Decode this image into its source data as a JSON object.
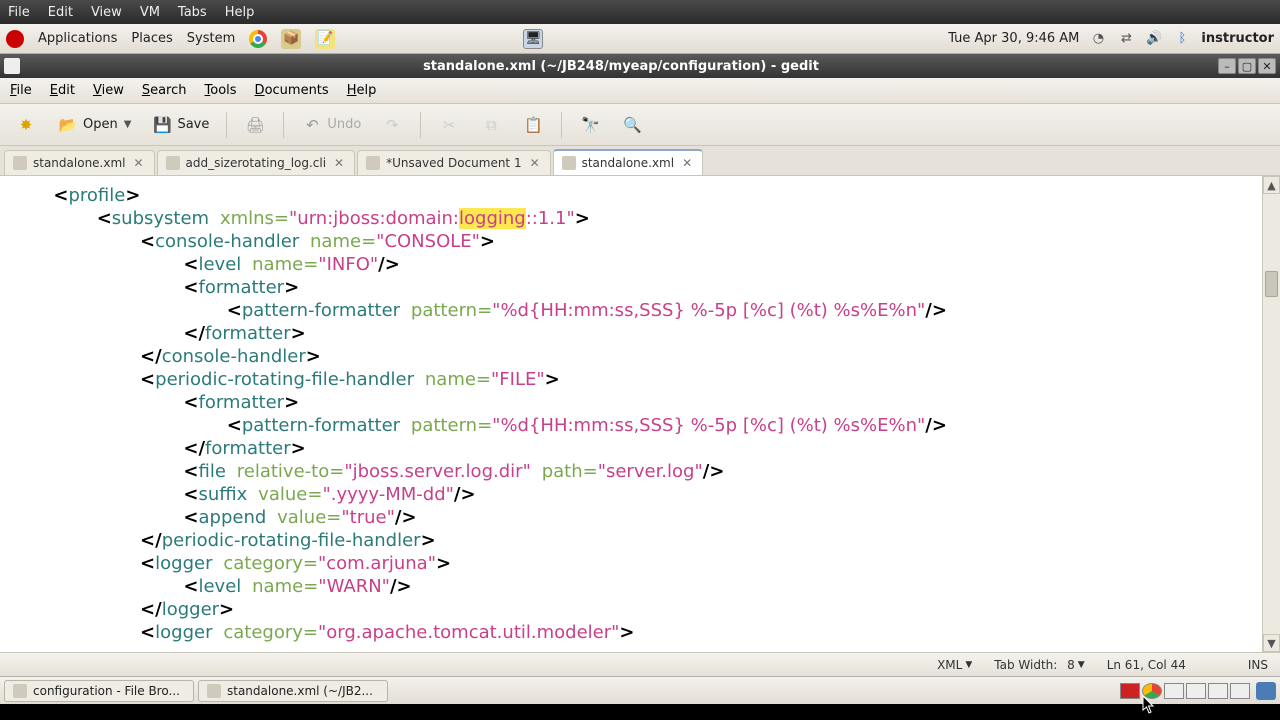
{
  "vm_menu": [
    "File",
    "Edit",
    "View",
    "VM",
    "Tabs",
    "Help"
  ],
  "gnome": {
    "applications": "Applications",
    "places": "Places",
    "system": "System",
    "clock": "Tue Apr 30,  9:46 AM",
    "user": "instructor"
  },
  "window": {
    "title": "standalone.xml (~/JB248/myeap/configuration) - gedit"
  },
  "app_menu": [
    "File",
    "Edit",
    "View",
    "Search",
    "Tools",
    "Documents",
    "Help"
  ],
  "toolbar": {
    "open": "Open",
    "save": "Save",
    "undo": "Undo"
  },
  "tabs": [
    {
      "label": "standalone.xml",
      "active": false
    },
    {
      "label": "add_sizerotating_log.cli",
      "active": false
    },
    {
      "label": "*Unsaved Document 1",
      "active": false
    },
    {
      "label": "standalone.xml",
      "active": true
    }
  ],
  "code": {
    "l1": {
      "tag": "profile"
    },
    "l2": {
      "tag": "subsystem",
      "attr": "xmlns",
      "valpre": "urn:jboss:domain:",
      "valhl": "logging",
      "valpost": ":1.1"
    },
    "l3": {
      "tag": "console-handler",
      "attr": "name",
      "val": "CONSOLE"
    },
    "l4": {
      "tag": "level",
      "attr": "name",
      "val": "INFO"
    },
    "l5": {
      "tag": "formatter"
    },
    "l6": {
      "tag": "pattern-formatter",
      "attr": "pattern",
      "val": "%d{HH:mm:ss,SSS} %-5p [%c] (%t) %s%E%n"
    },
    "l7": {
      "tag": "formatter"
    },
    "l8": {
      "tag": "console-handler"
    },
    "l9": {
      "tag": "periodic-rotating-file-handler",
      "attr": "name",
      "val": "FILE"
    },
    "l10": {
      "tag": "formatter"
    },
    "l11": {
      "tag": "pattern-formatter",
      "attr": "pattern",
      "val": "%d{HH:mm:ss,SSS} %-5p [%c] (%t) %s%E%n"
    },
    "l12": {
      "tag": "formatter"
    },
    "l13a": {
      "tag": "file",
      "attr1": "relative-to",
      "val1": "jboss.server.log.dir",
      "attr2": "path",
      "val2": "server.log"
    },
    "l14": {
      "tag": "suffix",
      "attr": "value",
      "val": ".yyyy-MM-dd"
    },
    "l15": {
      "tag": "append",
      "attr": "value",
      "val": "true"
    },
    "l16": {
      "tag": "periodic-rotating-file-handler"
    },
    "l17": {
      "tag": "logger",
      "attr": "category",
      "val": "com.arjuna"
    },
    "l18": {
      "tag": "level",
      "attr": "name",
      "val": "WARN"
    },
    "l19": {
      "tag": "logger"
    },
    "l20": {
      "tag": "logger",
      "attr": "category",
      "val": "org.apache.tomcat.util.modeler"
    }
  },
  "status": {
    "lang": "XML",
    "tabw_label": "Tab Width:",
    "tabw_val": "8",
    "pos": "Ln 61, Col 44",
    "ins": "INS"
  },
  "tasks": [
    "configuration - File Bro...",
    "standalone.xml (~/JB2..."
  ]
}
